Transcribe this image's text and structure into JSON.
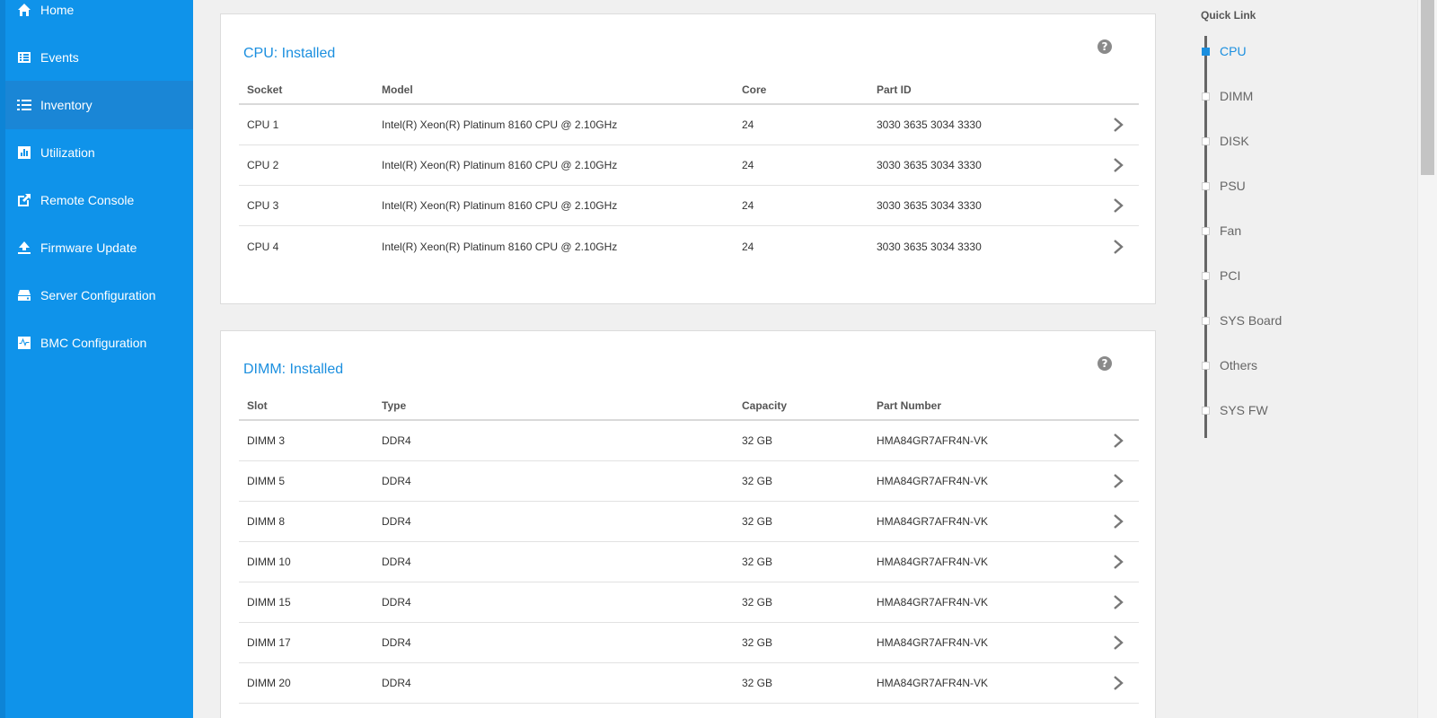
{
  "sidebar": {
    "items": [
      {
        "label": "Home",
        "icon": "home-icon"
      },
      {
        "label": "Events",
        "icon": "events-icon"
      },
      {
        "label": "Inventory",
        "icon": "list-icon",
        "active": true
      },
      {
        "label": "Utilization",
        "icon": "chart-icon"
      },
      {
        "label": "Remote Console",
        "icon": "external-link-icon"
      },
      {
        "label": "Firmware Update",
        "icon": "upload-icon"
      },
      {
        "label": "Server Configuration",
        "icon": "server-icon"
      },
      {
        "label": "BMC Configuration",
        "icon": "pulse-icon"
      }
    ]
  },
  "cpu": {
    "title": "CPU:  Installed",
    "headers": [
      "Socket",
      "Model",
      "Core",
      "Part ID"
    ],
    "rows": [
      [
        "CPU 1",
        "Intel(R) Xeon(R) Platinum 8160 CPU @ 2.10GHz",
        "24",
        "3030 3635 3034 3330"
      ],
      [
        "CPU 2",
        "Intel(R) Xeon(R) Platinum 8160 CPU @ 2.10GHz",
        "24",
        "3030 3635 3034 3330"
      ],
      [
        "CPU 3",
        "Intel(R) Xeon(R) Platinum 8160 CPU @ 2.10GHz",
        "24",
        "3030 3635 3034 3330"
      ],
      [
        "CPU 4",
        "Intel(R) Xeon(R) Platinum 8160 CPU @ 2.10GHz",
        "24",
        "3030 3635 3034 3330"
      ]
    ]
  },
  "dimm": {
    "title": "DIMM:  Installed",
    "headers": [
      "Slot",
      "Type",
      "Capacity",
      "Part Number"
    ],
    "rows": [
      [
        "DIMM 3",
        "DDR4",
        "32 GB",
        "HMA84GR7AFR4N-VK"
      ],
      [
        "DIMM 5",
        "DDR4",
        "32 GB",
        "HMA84GR7AFR4N-VK"
      ],
      [
        "DIMM 8",
        "DDR4",
        "32 GB",
        "HMA84GR7AFR4N-VK"
      ],
      [
        "DIMM 10",
        "DDR4",
        "32 GB",
        "HMA84GR7AFR4N-VK"
      ],
      [
        "DIMM 15",
        "DDR4",
        "32 GB",
        "HMA84GR7AFR4N-VK"
      ],
      [
        "DIMM 17",
        "DDR4",
        "32 GB",
        "HMA84GR7AFR4N-VK"
      ],
      [
        "DIMM 20",
        "DDR4",
        "32 GB",
        "HMA84GR7AFR4N-VK"
      ]
    ]
  },
  "quick_link": {
    "title": "Quick Link",
    "items": [
      "CPU",
      "DIMM",
      "DISK",
      "PSU",
      "Fan",
      "PCI",
      "SYS Board",
      "Others",
      "SYS FW"
    ],
    "active": "CPU"
  },
  "colors": {
    "sidebar_bg": "#0f93ea",
    "accent": "#1b8fdf"
  }
}
